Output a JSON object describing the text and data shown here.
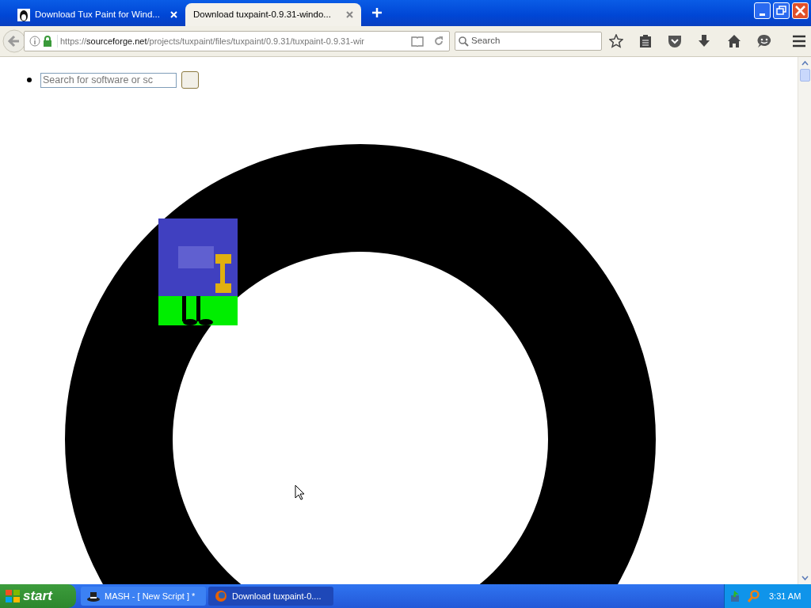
{
  "tabs": [
    {
      "title": "Download Tux Paint for Wind...",
      "selected": false
    },
    {
      "title": "Download tuxpaint-0.9.31-windo...",
      "selected": true
    }
  ],
  "address_bar": {
    "scheme": "https://",
    "host": "sourceforge.net",
    "path": "/projects/tuxpaint/files/tuxpaint/0.9.31/tuxpaint-0.9.31-wir"
  },
  "search_bar": {
    "placeholder": "Search"
  },
  "page": {
    "search_field": {
      "placeholder": "Search for software or sc"
    }
  },
  "taskbar": {
    "start_label": "start",
    "tasks": [
      {
        "label": "MASH - [ New Script ] *",
        "selected": false,
        "kind": "script"
      },
      {
        "label": "Download tuxpaint-0....",
        "selected": true,
        "kind": "browser"
      }
    ],
    "clock": "3:31 AM"
  }
}
